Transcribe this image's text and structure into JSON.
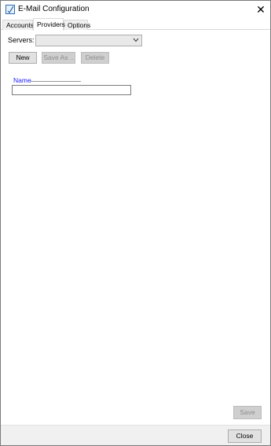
{
  "window": {
    "title": "E-Mail Configuration",
    "close_glyph": "✕"
  },
  "tabs": [
    {
      "label": "Accounts",
      "active": false
    },
    {
      "label": "Providers",
      "active": true
    },
    {
      "label": "Options",
      "active": false
    }
  ],
  "servers": {
    "label": "Servers:",
    "selected_value": ""
  },
  "toolbar": {
    "new_label": "New",
    "save_as_label": "Save As ..",
    "delete_label": "Delete"
  },
  "form": {
    "name_label": "Name",
    "name_value": ""
  },
  "footer": {
    "save_label": "Save",
    "close_label": "Close"
  },
  "icons": {
    "app": "mail-config-icon",
    "close": "close-icon",
    "dropdown": "chevron-down-icon"
  },
  "colors": {
    "name_label": "#1a1aff",
    "disabled_text": "#8d8d8d"
  }
}
